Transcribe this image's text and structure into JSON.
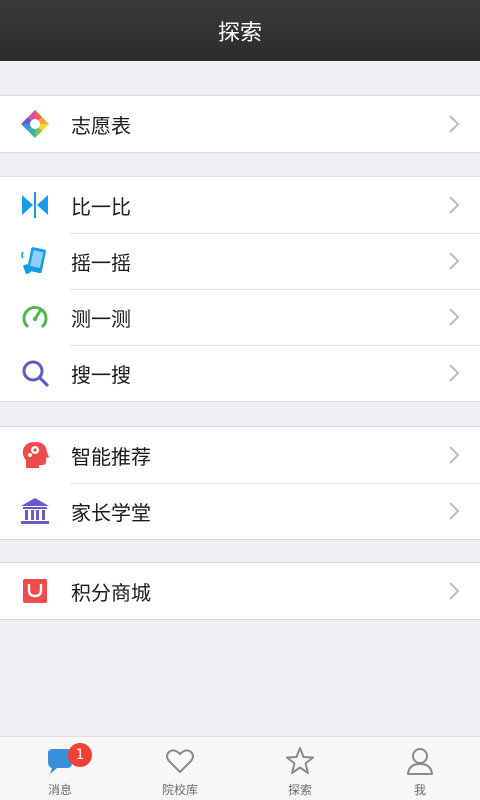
{
  "header": {
    "title": "探索"
  },
  "groups": [
    {
      "items": [
        {
          "label": "志愿表",
          "icon": "aperture-icon"
        }
      ]
    },
    {
      "items": [
        {
          "label": "比一比",
          "icon": "compare-icon"
        },
        {
          "label": "摇一摇",
          "icon": "shake-phone-icon"
        },
        {
          "label": "测一测",
          "icon": "speedometer-icon"
        },
        {
          "label": "搜一搜",
          "icon": "search-icon"
        }
      ]
    },
    {
      "items": [
        {
          "label": "智能推荐",
          "icon": "brain-head-icon"
        },
        {
          "label": "家长学堂",
          "icon": "school-building-icon"
        }
      ]
    },
    {
      "items": [
        {
          "label": "积分商城",
          "icon": "shopping-bag-icon"
        }
      ]
    }
  ],
  "tabbar": {
    "tabs": [
      {
        "label": "消息",
        "icon": "chat-bubble-icon",
        "badge": "1"
      },
      {
        "label": "院校库",
        "icon": "heart-icon"
      },
      {
        "label": "探索",
        "icon": "star-icon"
      },
      {
        "label": "我",
        "icon": "person-icon"
      }
    ]
  },
  "colors": {
    "header_bg": "#2e2e2e",
    "page_bg": "#efeff4",
    "badge": "#f04134",
    "icon_blue": "#1a9be8",
    "icon_green": "#4db848",
    "icon_purple": "#5a5fbf",
    "icon_red": "#ef4b4b"
  }
}
